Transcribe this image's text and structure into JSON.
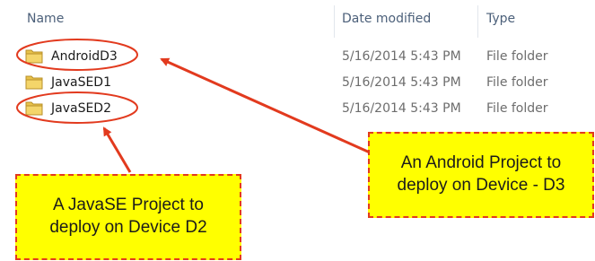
{
  "columns": {
    "name": "Name",
    "date_modified": "Date modified",
    "type": "Type"
  },
  "files": [
    {
      "name": "AndroidD3",
      "date": "5/16/2014 5:43 PM",
      "type": "File folder",
      "highlighted": true
    },
    {
      "name": "JavaSED1",
      "date": "5/16/2014 5:43 PM",
      "type": "File folder",
      "highlighted": false
    },
    {
      "name": "JavaSED2",
      "date": "5/16/2014 5:43 PM",
      "type": "File folder",
      "highlighted": true
    }
  ],
  "callouts": {
    "android": {
      "line1": "An Android Project to",
      "line2": "deploy on Device - D3"
    },
    "javase": {
      "line1": "A JavaSE Project to",
      "line2": "deploy on Device D2"
    }
  },
  "colors": {
    "accent": "#e23a1e",
    "callout_fill": "#ffff00",
    "folder": "#e8c24a"
  },
  "icons": {
    "folder": "folder-icon"
  }
}
